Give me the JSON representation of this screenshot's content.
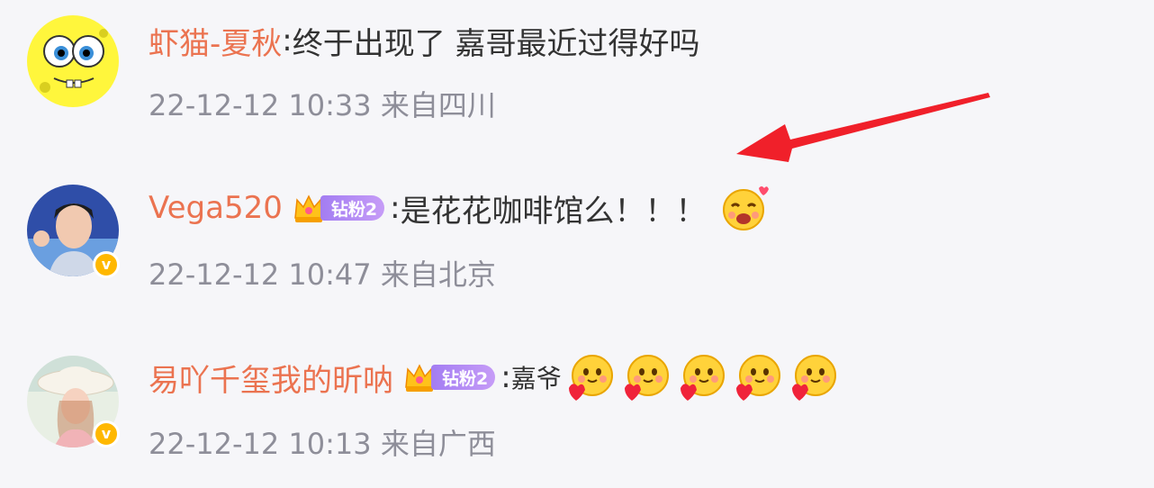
{
  "comments": [
    {
      "username": "虾猫-夏秋",
      "separator": ":",
      "text": "终于出现了 嘉哥最近过得好吗",
      "timestamp": "22-12-12 10:33",
      "location": "来自四川",
      "avatar_icon": "spongebob-avatar",
      "verified": false
    },
    {
      "username": "Vega520",
      "badge": "钻粉2",
      "separator": ":",
      "text": "是花花咖啡馆么！！！",
      "timestamp": "22-12-12 10:47",
      "location": "来自北京",
      "avatar_icon": "man-portrait-avatar",
      "verified": true,
      "emojis": [
        "heart-eyes-emoji"
      ]
    },
    {
      "username": "易吖千玺我的昕呐",
      "badge": "钻粉2",
      "separator": ":",
      "text": "嘉爷",
      "timestamp": "22-12-12 10:13",
      "location": "来自广西",
      "avatar_icon": "woman-hat-avatar",
      "verified": true,
      "emojis": [
        "holding-heart-emoji",
        "holding-heart-emoji",
        "holding-heart-emoji",
        "holding-heart-emoji",
        "holding-heart-emoji"
      ]
    }
  ],
  "colors": {
    "username": "#eb7350",
    "text": "#333333",
    "meta": "#8e8e99",
    "arrow": "#f0202a",
    "badge": "#b08af5",
    "verified": "#ffb800"
  }
}
